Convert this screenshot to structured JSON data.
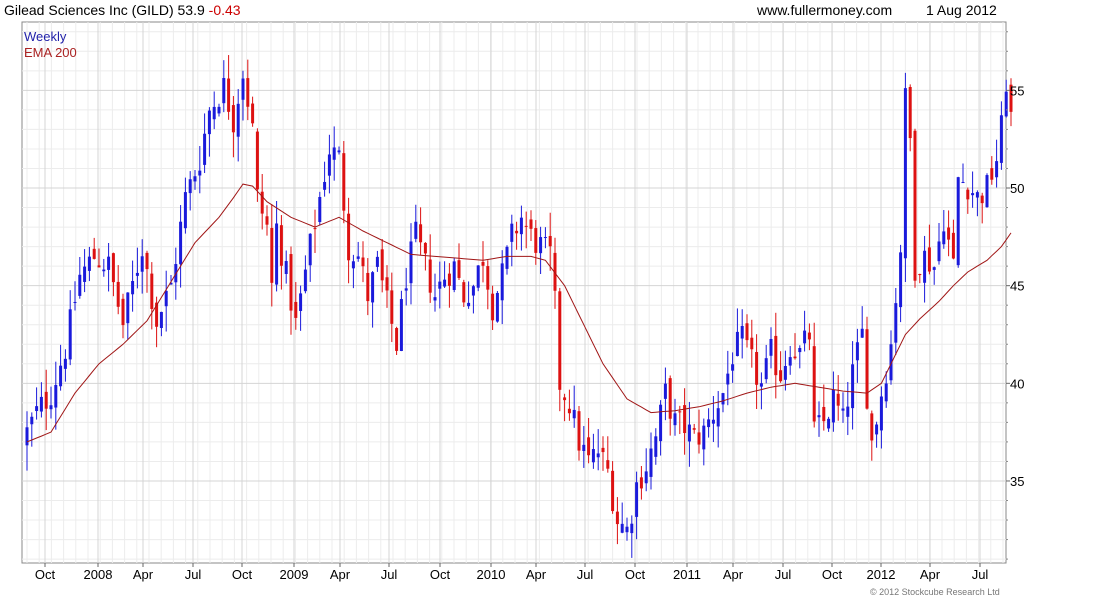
{
  "header": {
    "title_main": "Gilead Sciences Inc (GILD) 53.9",
    "title_change": "-0.43",
    "website": "www.fullermoney.com",
    "date": "1 Aug 2012"
  },
  "footer": {
    "copyright": "© 2012 Stockcube Research Ltd"
  },
  "colors": {
    "up": "#1a1adb",
    "down": "#dd1111",
    "ema": "#a01616",
    "grid": "#d4d4d4"
  },
  "chart_data": {
    "type": "candlestick",
    "frequency_label": "Weekly",
    "indicator_label": "EMA 200",
    "x_ticks": [
      "Oct",
      "2008",
      "Apr",
      "Jul",
      "Oct",
      "2009",
      "Apr",
      "Jul",
      "Oct",
      "2010",
      "Apr",
      "Jul",
      "Oct",
      "2011",
      "Apr",
      "Jul",
      "Oct",
      "2012",
      "Apr",
      "Jul"
    ],
    "y_ticks": [
      35,
      40,
      45,
      50,
      55
    ],
    "ylim": [
      30.8,
      58.5
    ],
    "grid": true,
    "y_axis_side": "right",
    "close_path": [
      [
        0,
        37.5
      ],
      [
        2,
        38.5
      ],
      [
        5,
        39.5
      ],
      [
        8,
        41.8
      ],
      [
        11,
        45.5
      ],
      [
        14,
        46.5
      ],
      [
        17,
        46
      ],
      [
        20,
        43
      ],
      [
        24,
        47
      ],
      [
        27,
        43.2
      ],
      [
        30,
        45
      ],
      [
        33,
        49.5
      ],
      [
        36,
        51.5
      ],
      [
        38,
        54
      ],
      [
        41,
        55.2
      ],
      [
        43,
        53.5
      ],
      [
        45,
        56
      ],
      [
        47,
        53
      ],
      [
        48,
        49.5
      ],
      [
        50,
        48
      ],
      [
        51,
        45
      ],
      [
        52,
        48
      ],
      [
        54,
        45.5
      ],
      [
        56,
        43
      ],
      [
        59,
        47
      ],
      [
        61,
        49.5
      ],
      [
        63,
        52
      ],
      [
        65,
        51.5
      ],
      [
        67,
        47
      ],
      [
        69,
        46.5
      ],
      [
        71,
        44.5
      ],
      [
        73,
        46
      ],
      [
        75,
        44
      ],
      [
        77,
        42
      ],
      [
        79,
        45.5
      ],
      [
        81,
        47.5
      ],
      [
        83,
        46
      ],
      [
        85,
        44.5
      ],
      [
        87,
        45.5
      ],
      [
        89,
        46
      ],
      [
        91,
        44.5
      ],
      [
        93,
        45
      ],
      [
        95,
        46.5
      ],
      [
        97,
        44
      ],
      [
        99,
        45.5
      ],
      [
        101,
        47.5
      ],
      [
        103,
        48.5
      ],
      [
        105,
        47.5
      ],
      [
        107,
        47
      ],
      [
        109,
        46.5
      ],
      [
        110,
        44
      ],
      [
        111,
        40
      ],
      [
        113,
        39
      ],
      [
        115,
        37
      ],
      [
        117,
        36
      ],
      [
        119,
        36.5
      ],
      [
        121,
        35.5
      ],
      [
        123,
        33
      ],
      [
        125,
        32.5
      ],
      [
        126,
        33.5
      ],
      [
        127,
        34.8
      ],
      [
        129,
        35.8
      ],
      [
        131,
        37.2
      ],
      [
        133,
        39.5
      ],
      [
        135,
        38
      ],
      [
        137,
        37.8
      ],
      [
        139,
        37.2
      ],
      [
        141,
        37.5
      ],
      [
        143,
        38.5
      ],
      [
        145,
        39.5
      ],
      [
        147,
        41.5
      ],
      [
        149,
        42.2
      ],
      [
        151,
        41
      ],
      [
        153,
        39.8
      ],
      [
        155,
        41.5
      ],
      [
        157,
        40.5
      ],
      [
        159,
        42
      ],
      [
        161,
        41.5
      ],
      [
        163,
        42.5
      ],
      [
        164,
        37.5
      ],
      [
        166,
        38
      ],
      [
        168,
        39.2
      ],
      [
        170,
        38
      ],
      [
        172,
        40.5
      ],
      [
        174,
        42.5
      ],
      [
        175,
        39.5
      ],
      [
        176,
        37
      ],
      [
        178,
        39.5
      ],
      [
        180,
        42
      ],
      [
        181,
        44.5
      ],
      [
        182,
        47
      ],
      [
        183,
        54.5
      ],
      [
        184,
        52.5
      ],
      [
        185,
        46
      ],
      [
        187,
        46.5
      ],
      [
        189,
        46
      ],
      [
        191,
        48.5
      ],
      [
        193,
        46
      ],
      [
        194,
        50.5
      ],
      [
        196,
        50.2
      ],
      [
        198,
        49.5
      ],
      [
        200,
        50
      ],
      [
        202,
        51.5
      ],
      [
        203,
        53
      ],
      [
        204,
        55.5
      ],
      [
        205,
        53.9
      ]
    ],
    "ema_path": [
      [
        0,
        37
      ],
      [
        5,
        37.5
      ],
      [
        10,
        39.5
      ],
      [
        15,
        41
      ],
      [
        20,
        42
      ],
      [
        25,
        43.2
      ],
      [
        30,
        45.2
      ],
      [
        35,
        47.2
      ],
      [
        40,
        48.5
      ],
      [
        43,
        49.5
      ],
      [
        45,
        50.2
      ],
      [
        47,
        50.1
      ],
      [
        50,
        49.3
      ],
      [
        55,
        48.5
      ],
      [
        60,
        48
      ],
      [
        65,
        48.5
      ],
      [
        70,
        47.8
      ],
      [
        75,
        47.2
      ],
      [
        80,
        46.6
      ],
      [
        85,
        46.5
      ],
      [
        90,
        46.4
      ],
      [
        95,
        46.3
      ],
      [
        100,
        46.5
      ],
      [
        105,
        46.5
      ],
      [
        108,
        46.3
      ],
      [
        112,
        45
      ],
      [
        116,
        43
      ],
      [
        120,
        41
      ],
      [
        125,
        39.2
      ],
      [
        130,
        38.5
      ],
      [
        135,
        38.6
      ],
      [
        140,
        38.8
      ],
      [
        145,
        39.1
      ],
      [
        150,
        39.5
      ],
      [
        155,
        39.8
      ],
      [
        160,
        40
      ],
      [
        165,
        39.8
      ],
      [
        170,
        39.6
      ],
      [
        175,
        39.5
      ],
      [
        178,
        40
      ],
      [
        180,
        41
      ],
      [
        183,
        42.5
      ],
      [
        186,
        43.3
      ],
      [
        190,
        44.2
      ],
      [
        193,
        45
      ],
      [
        196,
        45.7
      ],
      [
        200,
        46.3
      ],
      [
        203,
        47
      ],
      [
        205,
        47.7
      ]
    ]
  }
}
